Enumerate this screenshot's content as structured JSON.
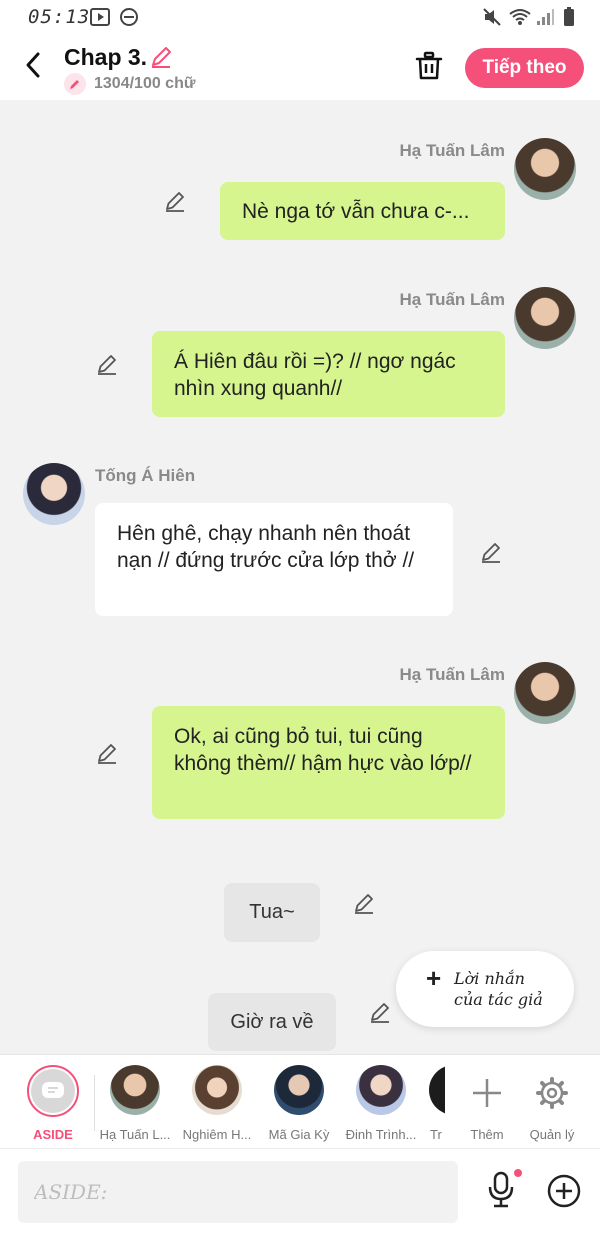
{
  "status_bar": {
    "time": "05:13"
  },
  "header": {
    "title": "Chap 3.",
    "word_count": "1304/100 chữ",
    "next_label": "Tiếp theo"
  },
  "messages": [
    {
      "sender": "Hạ Tuấn Lâm",
      "text": "Nè nga tớ vẫn chưa c-...",
      "side": "right"
    },
    {
      "sender": "Hạ Tuấn Lâm",
      "text": "Á Hiên đâu rồi =)? // ngơ ngác nhìn xung quanh//",
      "side": "right"
    },
    {
      "sender": "Tống Á Hiên",
      "text": "Hên ghê, chạy nhanh nên thoát nạn // đứng trước cửa lớp thở //",
      "side": "left"
    },
    {
      "sender": "Hạ Tuấn Lâm",
      "text": "Ok, ai cũng bỏ tui, tui cũng không thèm// hậm hực vào lớp//",
      "side": "right"
    },
    {
      "text": "Tua~",
      "side": "aside"
    },
    {
      "text": "Giờ ra về",
      "side": "aside"
    }
  ],
  "author_note": {
    "line1": "Lời nhắn",
    "line2": "của tác giả"
  },
  "characters": {
    "aside": "ASIDE",
    "list": [
      "Hạ Tuấn L...",
      "Nghiêm H...",
      "Mã Gia Kỳ",
      "Đinh Trình...",
      "Tr"
    ],
    "add": "Thêm",
    "manage": "Quản lý"
  },
  "input": {
    "placeholder": "ASIDE:"
  },
  "colors": {
    "accent": "#f4507a",
    "green_bubble": "#d6f58f"
  }
}
